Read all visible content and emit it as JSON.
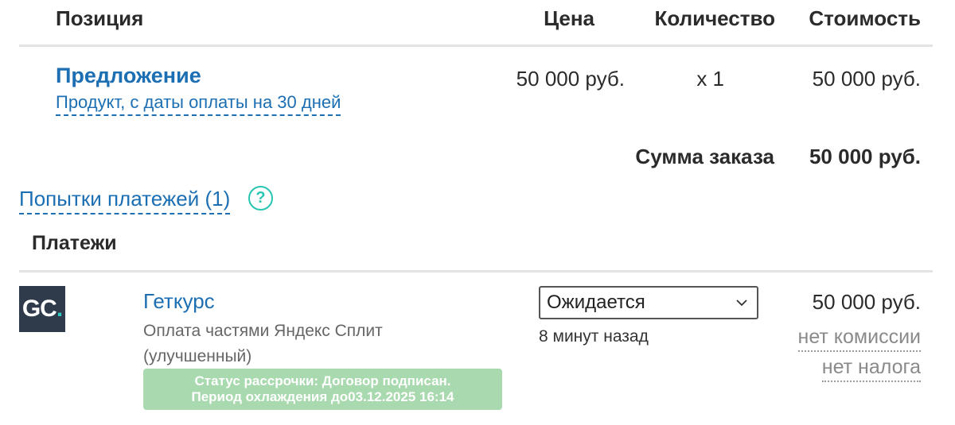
{
  "table_header": {
    "position": "Позиция",
    "price": "Цена",
    "quantity": "Количество",
    "cost": "Стоимость"
  },
  "item": {
    "title": "Предложение",
    "subtitle": "Продукт, с даты оплаты на 30 дней",
    "price": "50 000 руб.",
    "quantity": "x 1",
    "cost": "50 000 руб."
  },
  "total": {
    "label": "Сумма заказа",
    "value": "50 000 руб."
  },
  "attempts_link": "Попытки платежей (1)",
  "help_glyph": "?",
  "payments_heading": "Платежи",
  "payment": {
    "logo_text": "GC",
    "logo_dot": ".",
    "name": "Геткурс",
    "method": "Оплата частями Яндекс Сплит (улучшенный)",
    "status_line1": "Статус рассрочки: Договор подписан.",
    "status_line2": "Период охлаждения до03.12.2025 16:14",
    "selected_status": "Ожидается",
    "time_ago": "8 минут назад",
    "amount": "50 000 руб.",
    "commission": "нет комиссии",
    "tax": "нет налога"
  },
  "colors": {
    "link": "#1c6fb3",
    "help_icon": "#29c6b3",
    "status_bg": "#a9d9ae",
    "logo_bg": "#2f3a4a"
  }
}
